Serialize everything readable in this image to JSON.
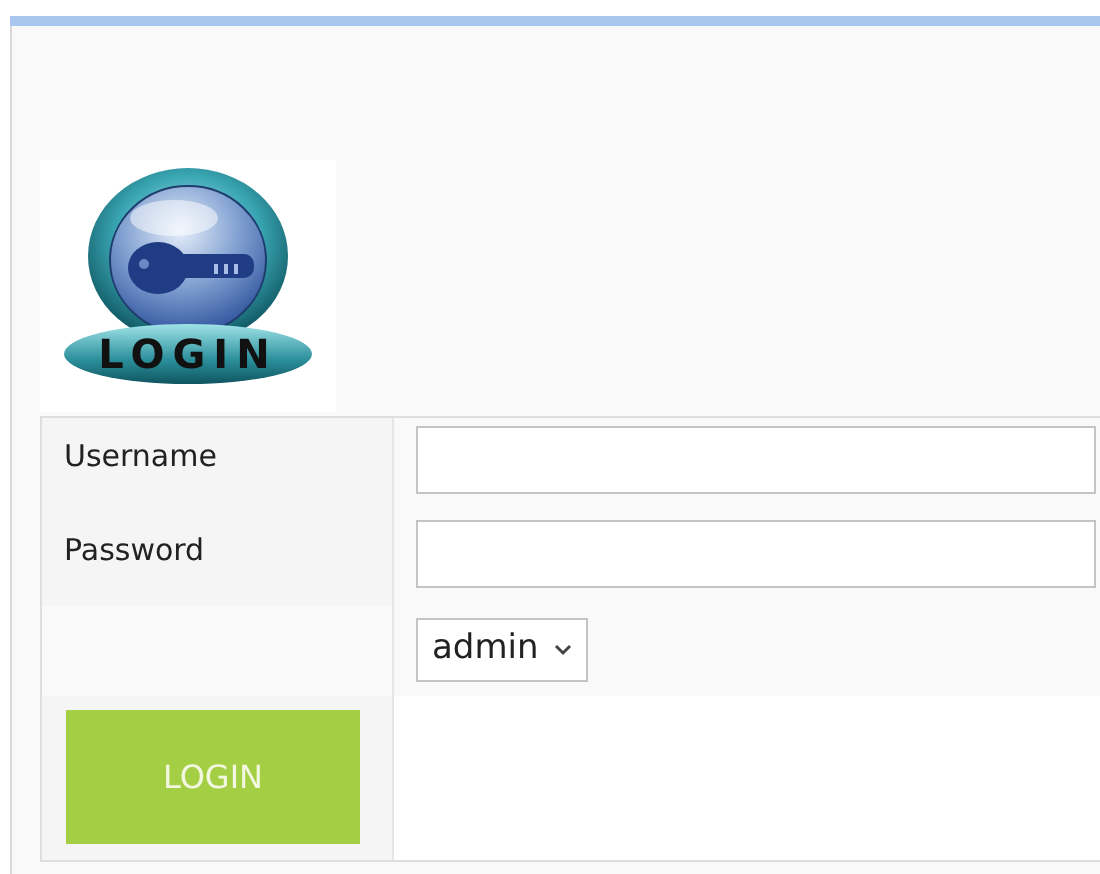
{
  "logo": {
    "text": "LOGIN"
  },
  "form": {
    "fields": [
      {
        "label": "Username"
      },
      {
        "label": "Password"
      }
    ],
    "role_select": {
      "value": "admin"
    },
    "submit": {
      "label": "LOGIN"
    }
  }
}
